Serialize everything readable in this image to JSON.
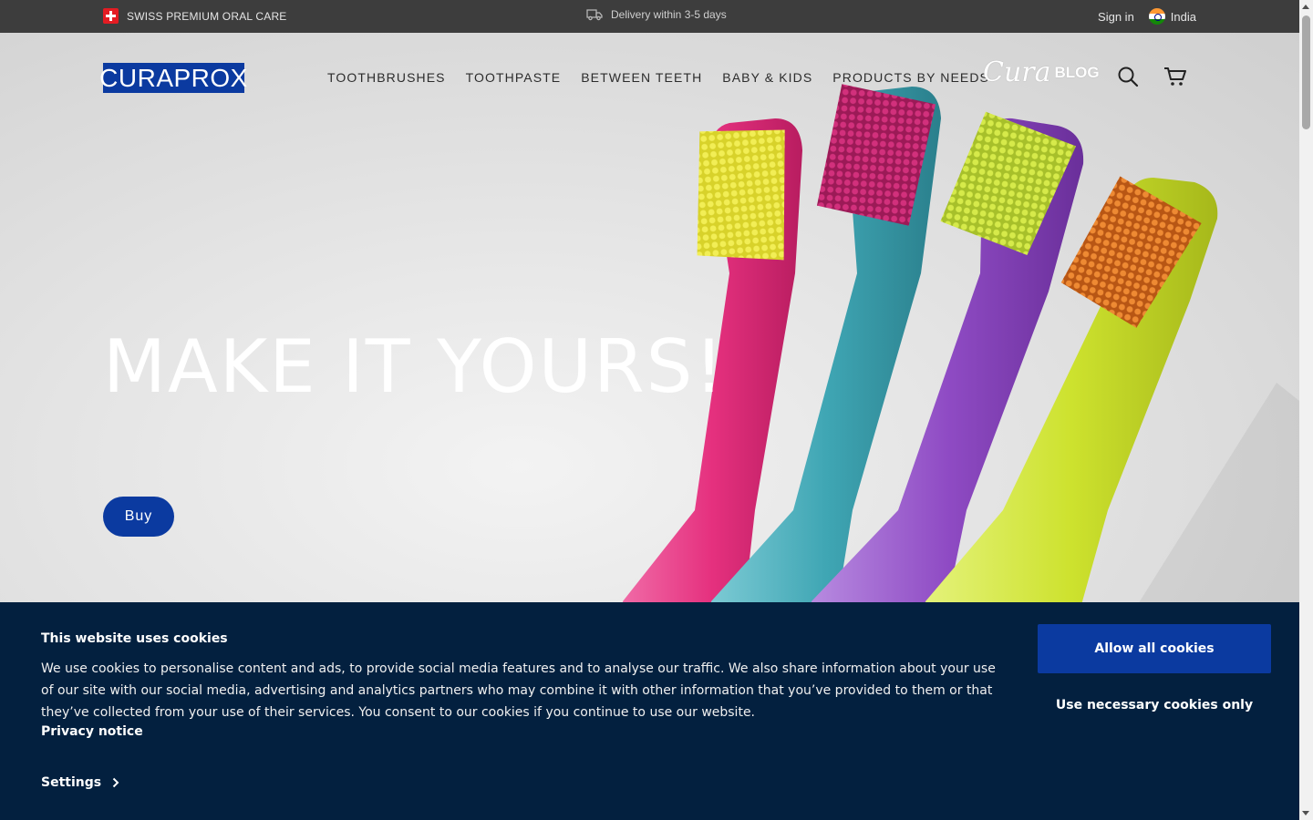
{
  "topbar": {
    "tagline": "SWISS PREMIUM ORAL CARE",
    "delivery": "Delivery within 3-5 days",
    "sign_in": "Sign in",
    "country": "India"
  },
  "header": {
    "logo": "CURAPROX",
    "nav": [
      {
        "label": "TOOTHBRUSHES"
      },
      {
        "label": "TOOTHPASTE"
      },
      {
        "label": "BETWEEN TEETH"
      },
      {
        "label": "BABY & KIDS"
      },
      {
        "label": "PRODUCTS BY NEEDS"
      }
    ],
    "blog_script": "Cura",
    "blog_word": "BLOG"
  },
  "hero": {
    "title": "MAKE IT YOURS!",
    "cta": "Buy",
    "brush_colors": [
      "#e5307e",
      "#3fa6b4",
      "#8f4bc4",
      "#cde22e"
    ],
    "bristle_colors": [
      "#e7e43a",
      "#c2236e",
      "#c9e03a",
      "#e07421"
    ]
  },
  "cookie_banner": {
    "title": "This website uses cookies",
    "body": "We use cookies to personalise content and ads, to provide social media features and to analyse our traffic. We also share information about your use of our site with our social media, advertising and analytics partners who may combine it with other information that you’ve provided to them or that they’ve collected from your use of their services. You consent to our cookies if you continue to use our website.",
    "privacy_link": "Privacy notice",
    "settings_link": "Settings",
    "allow_all": "Allow all cookies",
    "necessary_only": "Use necessary cookies only"
  },
  "colors": {
    "brand_blue": "#0b3aa0",
    "topbar_bg": "#3d3d3d",
    "cookie_bg": "#03203f"
  },
  "icons": [
    "swiss-flag-icon",
    "truck-icon",
    "india-flag-icon",
    "search-icon",
    "cart-icon",
    "chevron-right-icon"
  ]
}
